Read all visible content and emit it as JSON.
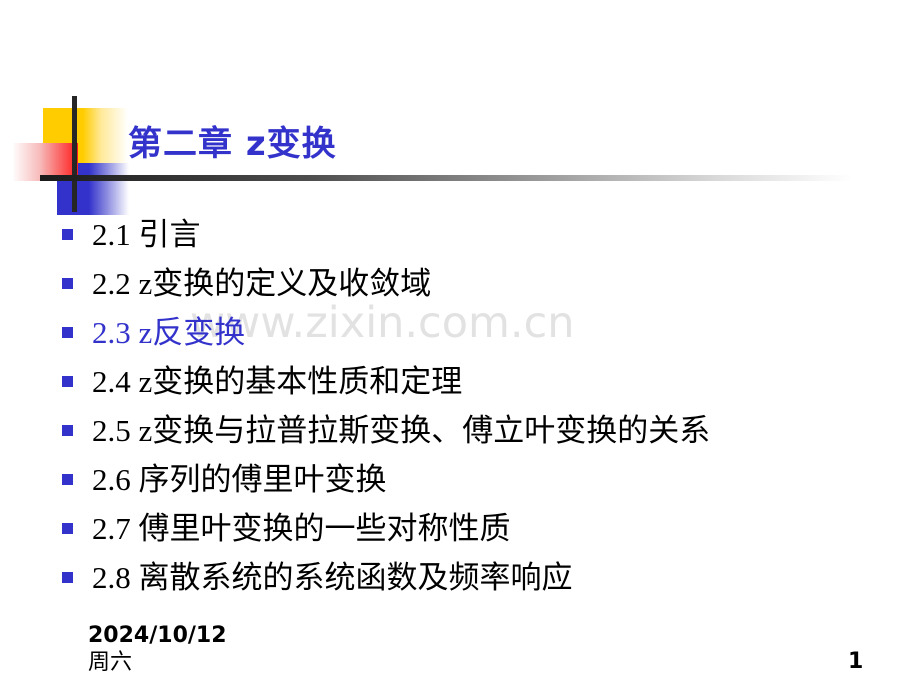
{
  "slide": {
    "title": "第二章  z变换",
    "title_color": "#3333CC",
    "watermark": "www.zixin.com.cn",
    "watermark_color": "#E2E2E2",
    "background_color": "#FFFFFF"
  },
  "decoration": {
    "yellow_color": "#FFCC00",
    "blue_color": "#3333CC",
    "red_color": "#FF1A1A",
    "rule_color": "#262626"
  },
  "outline": {
    "bullet_color": "#3333CC",
    "items": [
      {
        "label": "2.1  引言",
        "accent": false
      },
      {
        "label": "2.2  z变换的定义及收敛域",
        "accent": false
      },
      {
        "label": "2.3  z反变换",
        "accent": true
      },
      {
        "label": "2.4  z变换的基本性质和定理",
        "accent": false
      },
      {
        "label": "2.5  z变换与拉普拉斯变换、傅立叶变换的关系",
        "accent": false
      },
      {
        "label": "2.6  序列的傅里叶变换",
        "accent": false
      },
      {
        "label": "2.7  傅里叶变换的一些对称性质",
        "accent": false
      },
      {
        "label": "2.8  离散系统的系统函数及频率响应",
        "accent": false
      }
    ]
  },
  "footer": {
    "date": "2024/10/12",
    "weekday": "周六",
    "page_number": "1"
  }
}
